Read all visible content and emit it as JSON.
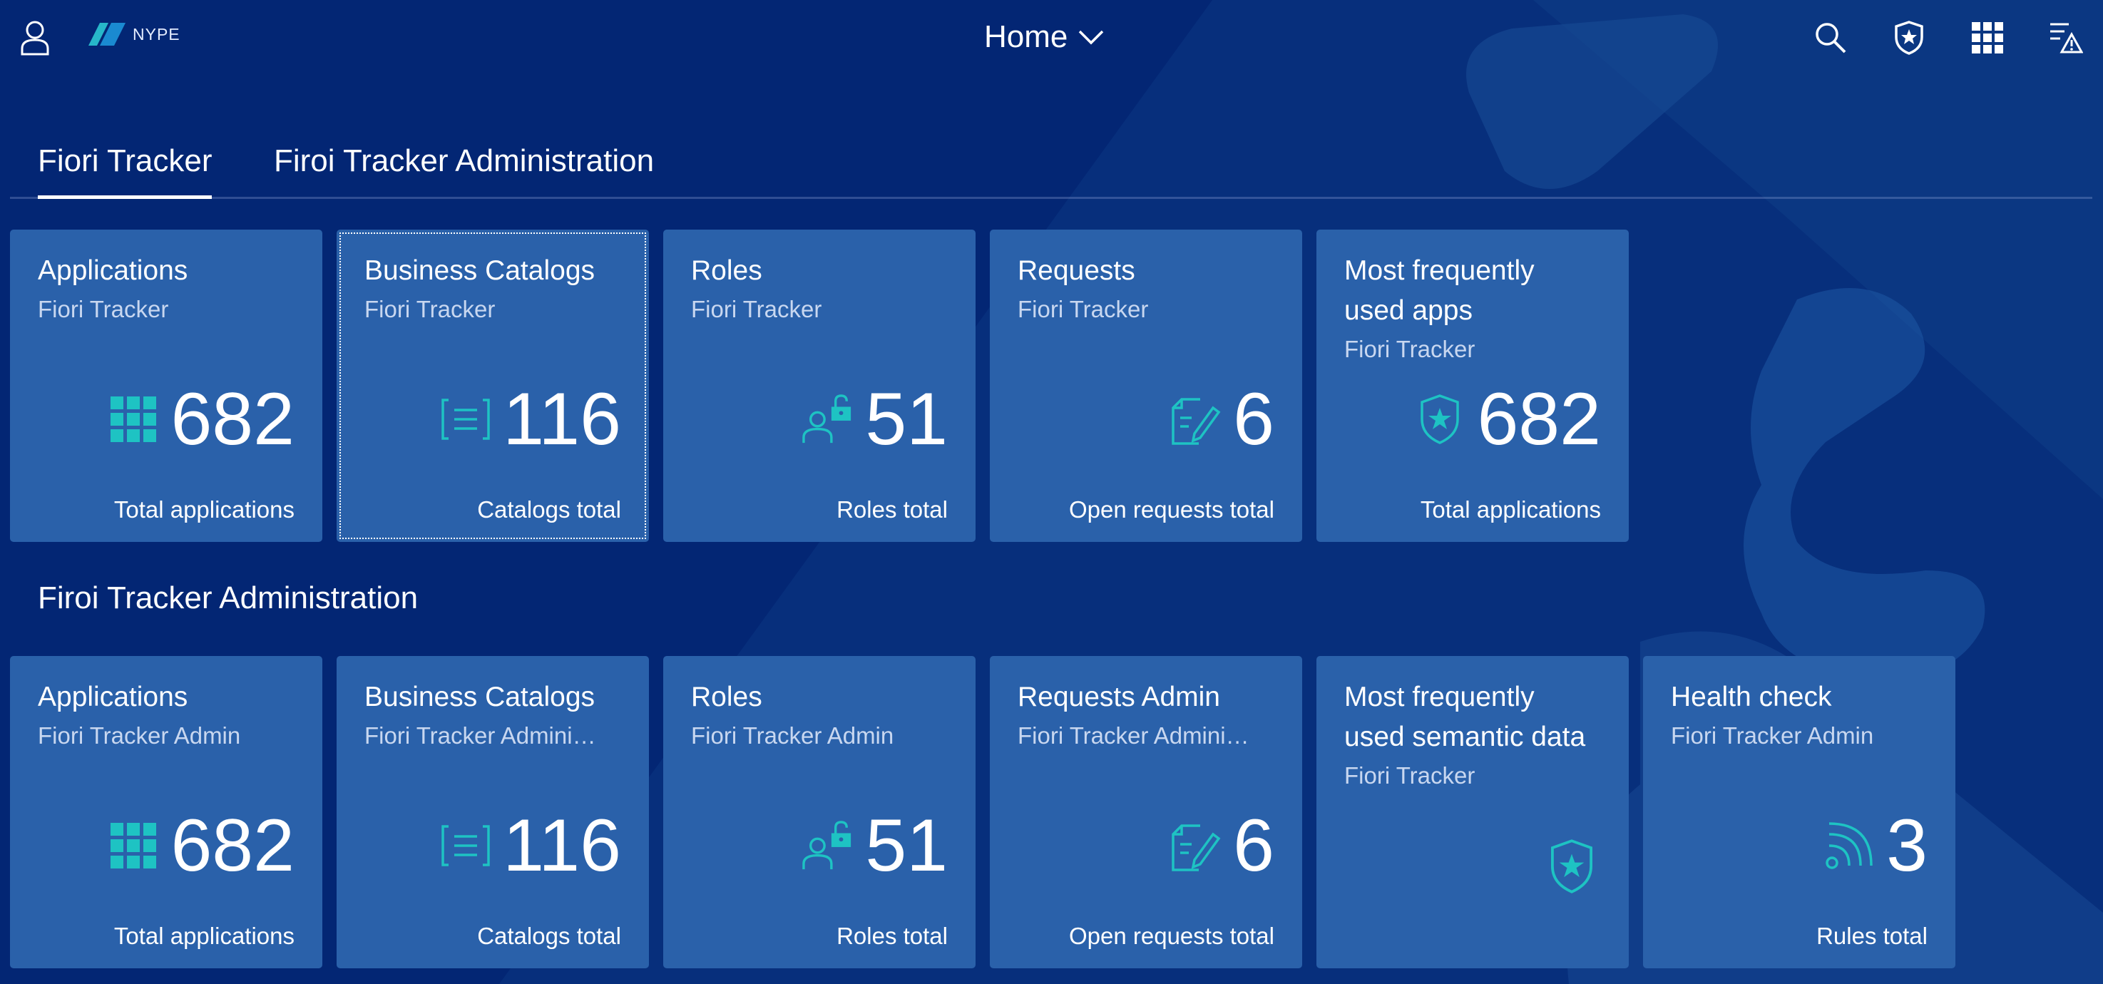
{
  "shell": {
    "logo_text": "NYPE",
    "home_title": "Home",
    "icons": [
      "user-icon",
      "search-icon",
      "badge-icon",
      "app-grid-icon",
      "notifications-warning-icon"
    ]
  },
  "tabs": [
    {
      "label": "Fiori Tracker",
      "active": true
    },
    {
      "label": "Firoi Tracker Administration",
      "active": false
    }
  ],
  "section2_title": "Firoi Tracker Administration",
  "colors": {
    "background": "#032674",
    "tile": "#2a61aa",
    "accent": "#1ec3c3"
  },
  "group1": [
    {
      "title": "Applications",
      "subtitle": "Fiori Tracker",
      "value": "682",
      "footer": "Total applications",
      "icon": "apps-grid-icon"
    },
    {
      "title": "Business Catalogs",
      "subtitle": "Fiori Tracker",
      "value": "116",
      "footer": "Catalogs total",
      "icon": "catalog-icon"
    },
    {
      "title": "Roles",
      "subtitle": "Fiori Tracker",
      "value": "51",
      "footer": "Roles total",
      "icon": "role-unlock-icon"
    },
    {
      "title": "Requests",
      "subtitle": "Fiori Tracker",
      "value": "6",
      "footer": "Open requests total",
      "icon": "document-edit-icon"
    },
    {
      "title": "Most frequently used apps",
      "title_line1": "Most frequently",
      "title_line2": "used apps",
      "subtitle": "Fiori Tracker",
      "value": "682",
      "footer": "Total applications",
      "icon": "badge-icon"
    }
  ],
  "group2": [
    {
      "title": "Applications",
      "subtitle": "Fiori Tracker Admin",
      "value": "682",
      "footer": "Total applications",
      "icon": "apps-grid-icon"
    },
    {
      "title": "Business Catalogs",
      "subtitle": "Fiori Tracker Admini…",
      "value": "116",
      "footer": "Catalogs total",
      "icon": "catalog-icon"
    },
    {
      "title": "Roles",
      "subtitle": "Fiori Tracker Admin",
      "value": "51",
      "footer": "Roles total",
      "icon": "role-unlock-icon"
    },
    {
      "title": "Requests Admin",
      "subtitle": "Fiori Tracker Admini…",
      "value": "6",
      "footer": "Open requests total",
      "icon": "document-edit-icon"
    },
    {
      "title": "Most frequently used semantic data",
      "title_line1": "Most frequently",
      "title_line2": "used semantic data",
      "subtitle": "Fiori Tracker",
      "icon": "badge-icon"
    },
    {
      "title": "Health check",
      "subtitle": "Fiori Tracker Admin",
      "value": "3",
      "footer": "Rules total",
      "icon": "signal-icon"
    }
  ]
}
